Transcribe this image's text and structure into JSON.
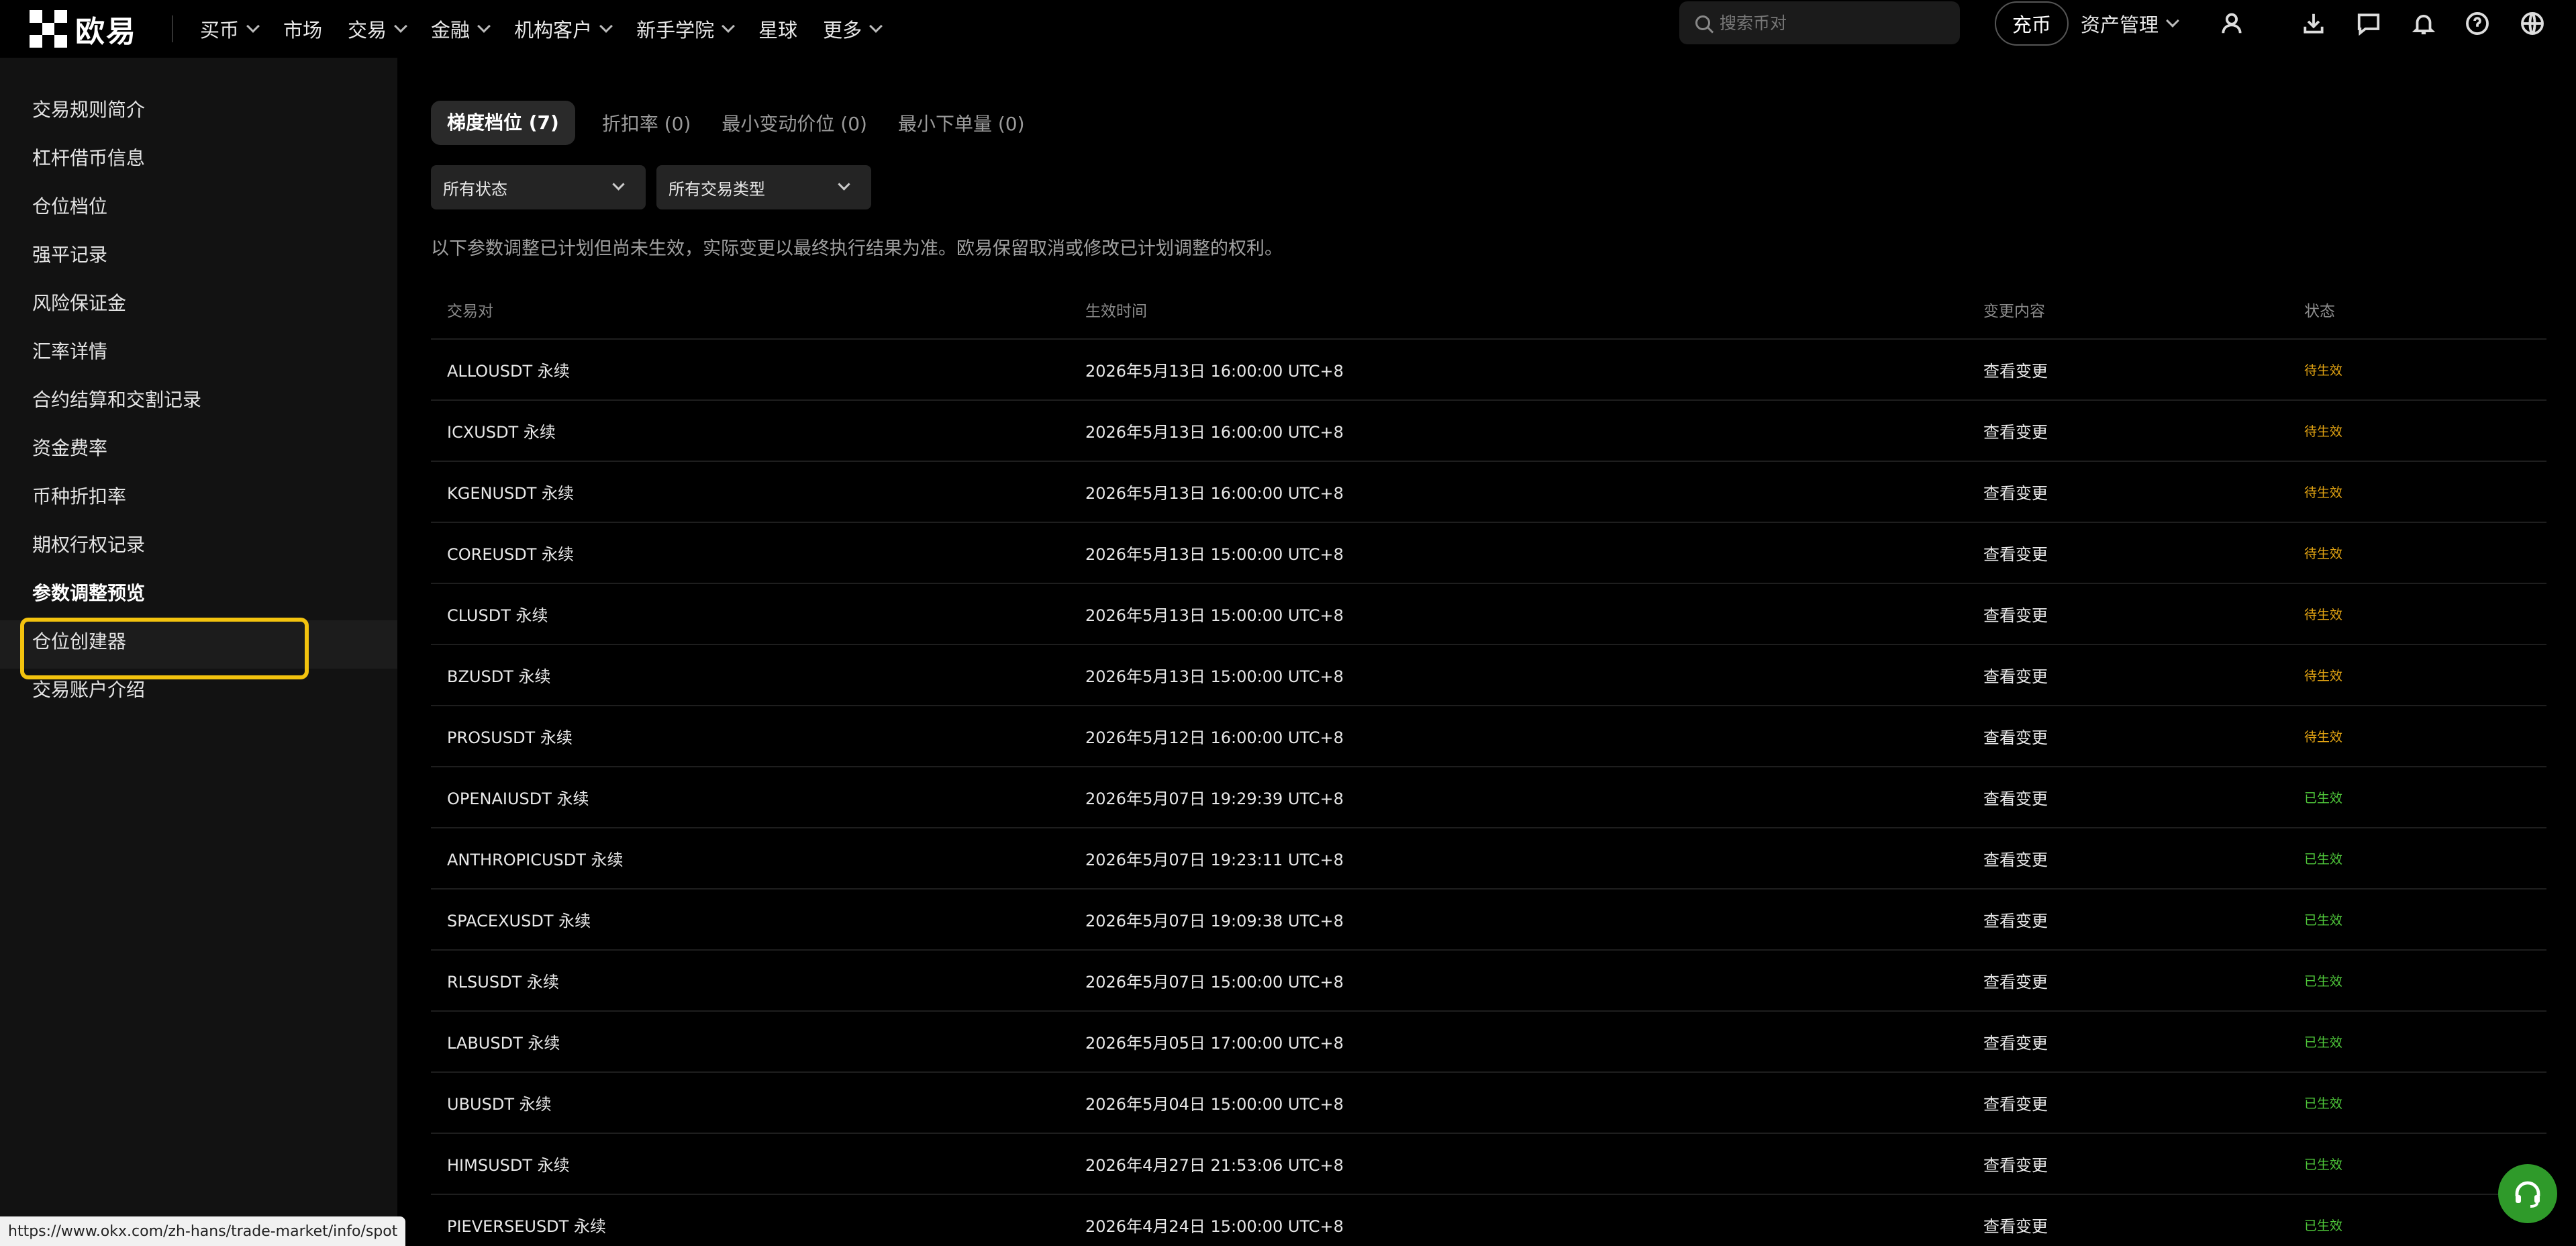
{
  "brand": {
    "name": "欧易"
  },
  "nav": {
    "items": [
      {
        "label": "买币",
        "dropdown": true
      },
      {
        "label": "市场",
        "dropdown": false
      },
      {
        "label": "交易",
        "dropdown": true
      },
      {
        "label": "金融",
        "dropdown": true
      },
      {
        "label": "机构客户",
        "dropdown": true
      },
      {
        "label": "新手学院",
        "dropdown": true
      },
      {
        "label": "星球",
        "dropdown": false
      },
      {
        "label": "更多",
        "dropdown": true
      }
    ],
    "search_placeholder": "搜索币对",
    "deposit_label": "充币",
    "asset_label": "资产管理"
  },
  "sidebar": {
    "items": [
      {
        "label": "交易规则简介"
      },
      {
        "label": "杠杆借币信息"
      },
      {
        "label": "仓位档位"
      },
      {
        "label": "强平记录"
      },
      {
        "label": "风险保证金"
      },
      {
        "label": "汇率详情"
      },
      {
        "label": "合约结算和交割记录"
      },
      {
        "label": "资金费率"
      },
      {
        "label": "币种折扣率"
      },
      {
        "label": "期权行权记录"
      },
      {
        "label": "参数调整预览"
      },
      {
        "label": "仓位创建器"
      },
      {
        "label": "交易账户介绍"
      }
    ],
    "active_index": 10
  },
  "tabs": [
    {
      "label": "梯度档位 (7)"
    },
    {
      "label": "折扣率 (0)"
    },
    {
      "label": "最小变动价位 (0)"
    },
    {
      "label": "最小下单量 (0)"
    }
  ],
  "filters": {
    "status": "所有状态",
    "type": "所有交易类型"
  },
  "notice": "以下参数调整已计划但尚未生效，实际变更以最终执行结果为准。欧易保留取消或修改已计划调整的权利。",
  "table": {
    "headers": {
      "pair": "交易对",
      "time": "生效时间",
      "change": "变更内容",
      "status": "状态"
    },
    "rows": [
      {
        "pair": "ALLOUSDT 永续",
        "time": "2026年5月13日 16:00:00 UTC+8",
        "change": "查看变更",
        "status": "待生效"
      },
      {
        "pair": "ICXUSDT 永续",
        "time": "2026年5月13日 16:00:00 UTC+8",
        "change": "查看变更",
        "status": "待生效"
      },
      {
        "pair": "KGENUSDT 永续",
        "time": "2026年5月13日 16:00:00 UTC+8",
        "change": "查看变更",
        "status": "待生效"
      },
      {
        "pair": "COREUSDT 永续",
        "time": "2026年5月13日 15:00:00 UTC+8",
        "change": "查看变更",
        "status": "待生效"
      },
      {
        "pair": "CLUSDT 永续",
        "time": "2026年5月13日 15:00:00 UTC+8",
        "change": "查看变更",
        "status": "待生效"
      },
      {
        "pair": "BZUSDT 永续",
        "time": "2026年5月13日 15:00:00 UTC+8",
        "change": "查看变更",
        "status": "待生效"
      },
      {
        "pair": "PROSUSDT 永续",
        "time": "2026年5月12日 16:00:00 UTC+8",
        "change": "查看变更",
        "status": "待生效"
      },
      {
        "pair": "OPENAIUSDT 永续",
        "time": "2026年5月07日 19:29:39 UTC+8",
        "change": "查看变更",
        "status": "已生效"
      },
      {
        "pair": "ANTHROPICUSDT 永续",
        "time": "2026年5月07日 19:23:11 UTC+8",
        "change": "查看变更",
        "status": "已生效"
      },
      {
        "pair": "SPACEXUSDT 永续",
        "time": "2026年5月07日 19:09:38 UTC+8",
        "change": "查看变更",
        "status": "已生效"
      },
      {
        "pair": "RLSUSDT 永续",
        "time": "2026年5月07日 15:00:00 UTC+8",
        "change": "查看变更",
        "status": "已生效"
      },
      {
        "pair": "LABUSDT 永续",
        "time": "2026年5月05日 17:00:00 UTC+8",
        "change": "查看变更",
        "status": "已生效"
      },
      {
        "pair": "UBUSDT 永续",
        "time": "2026年5月04日 15:00:00 UTC+8",
        "change": "查看变更",
        "status": "已生效"
      },
      {
        "pair": "HIMSUSDT 永续",
        "time": "2026年4月27日 21:53:06 UTC+8",
        "change": "查看变更",
        "status": "已生效"
      },
      {
        "pair": "PIEVERSEUSDT 永续",
        "time": "2026年4月24日 15:00:00 UTC+8",
        "change": "查看变更",
        "status": "已生效"
      }
    ]
  },
  "status_url": "https://www.okx.com/zh-hans/trade-market/info/spot",
  "colors": {
    "pending": "#e3a412",
    "effective": "#4fc83a",
    "highlight": "#f3c30e",
    "support": "#2f9a2a"
  },
  "icons": [
    "logo-icon",
    "search-icon",
    "user-icon",
    "download-icon",
    "message-icon",
    "bell-icon",
    "help-icon",
    "globe-icon",
    "headset-icon"
  ]
}
